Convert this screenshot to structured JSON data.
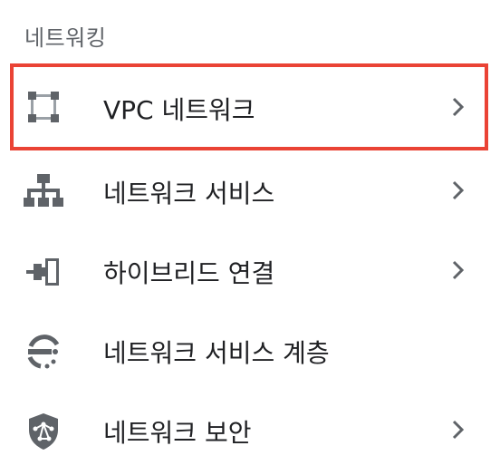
{
  "section": {
    "title": "네트워킹"
  },
  "items": [
    {
      "label": "VPC 네트워크",
      "icon": "vpc-network-icon",
      "has_chevron": true,
      "selected": true
    },
    {
      "label": "네트워크 서비스",
      "icon": "network-services-icon",
      "has_chevron": true,
      "selected": false
    },
    {
      "label": "하이브리드 연결",
      "icon": "hybrid-connectivity-icon",
      "has_chevron": true,
      "selected": false
    },
    {
      "label": "네트워크 서비스 계층",
      "icon": "network-service-tiers-icon",
      "has_chevron": false,
      "selected": false
    },
    {
      "label": "네트워크 보안",
      "icon": "network-security-icon",
      "has_chevron": true,
      "selected": false
    }
  ],
  "colors": {
    "icon": "#5f6368",
    "text": "#202124",
    "highlight": "#ea4335"
  }
}
